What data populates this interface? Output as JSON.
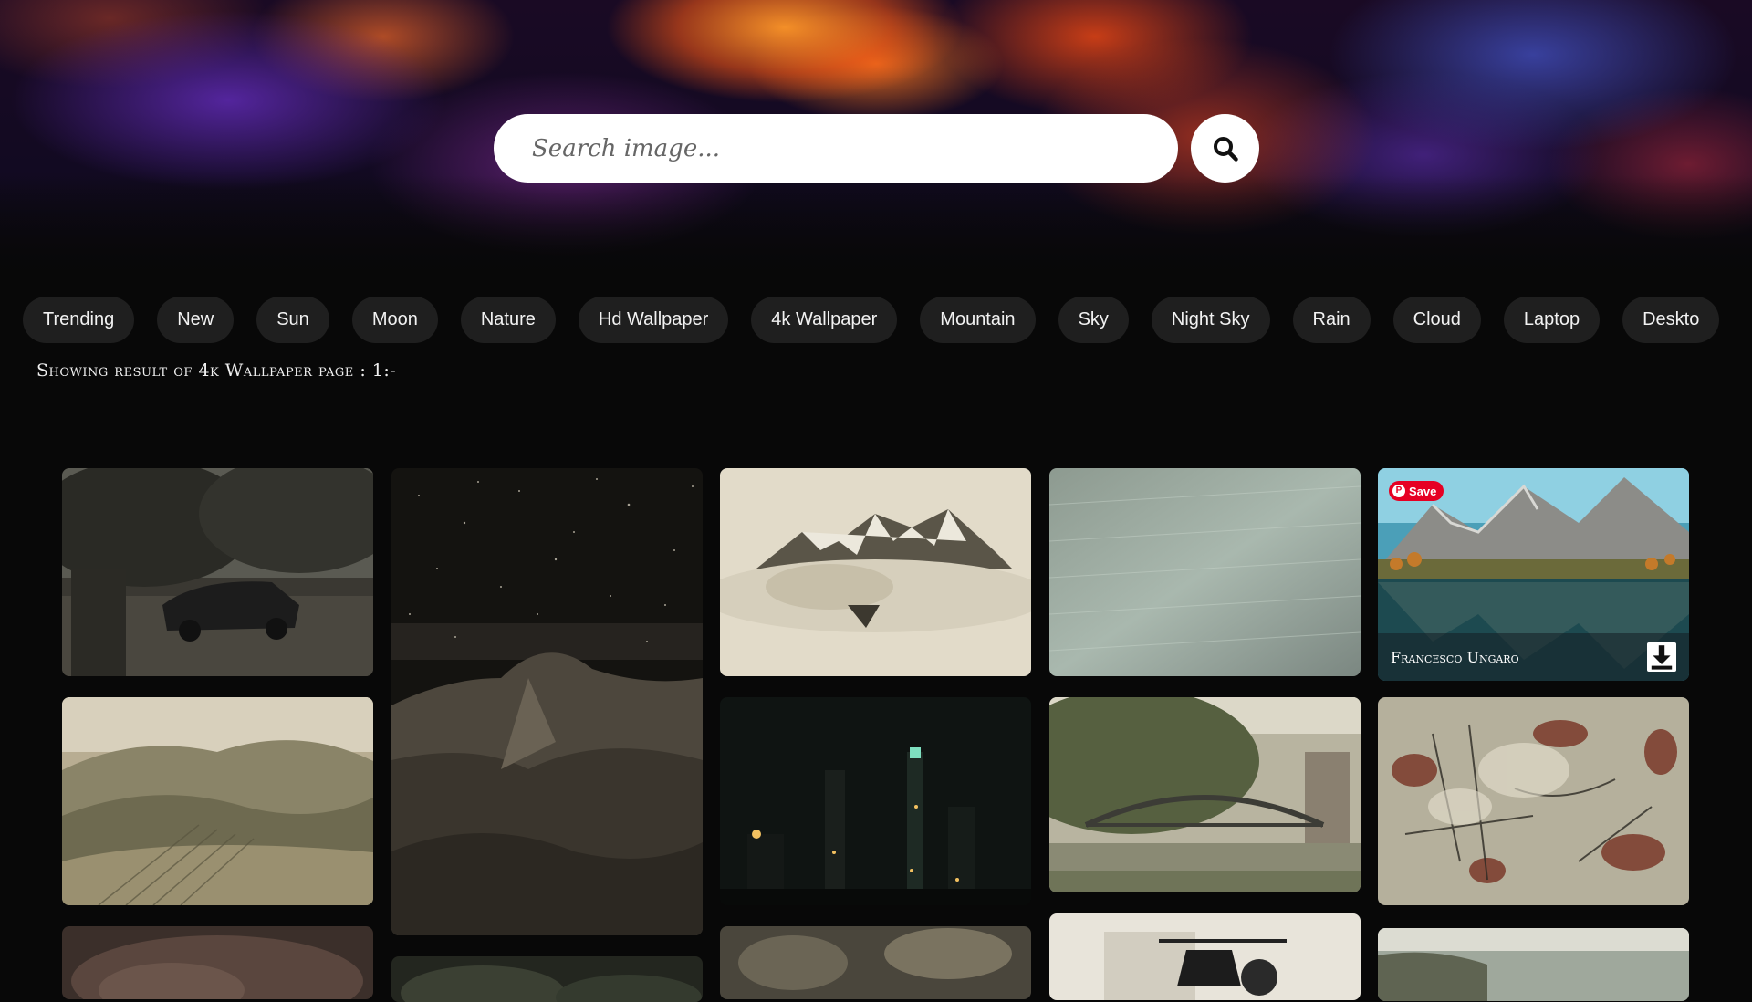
{
  "search": {
    "placeholder": "Search image...",
    "button_icon": "search-icon"
  },
  "tags": [
    "Trending",
    "New",
    "Sun",
    "Moon",
    "Nature",
    "Hd Wallpaper",
    "4k Wallpaper",
    "Mountain",
    "Sky",
    "Night Sky",
    "Rain",
    "Cloud",
    "Laptop",
    "Deskto"
  ],
  "results": {
    "heading": "Showing result of 4k Wallpaper page : 1:-"
  },
  "featured": {
    "save_label": "Save",
    "photographer": "Francesco Ungaro",
    "download_icon": "download-icon"
  },
  "colors": {
    "page_bg": "#080808",
    "tag_bg": "#1f1f1f",
    "pinterest_red": "#e60023"
  }
}
